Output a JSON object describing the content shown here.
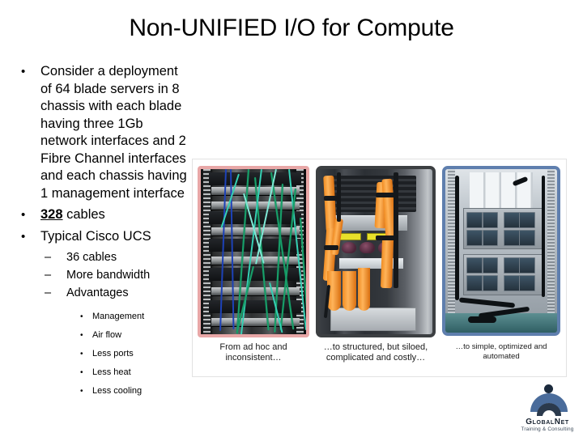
{
  "slide": {
    "title": "Non-UNIFIED I/O for Compute"
  },
  "bullets": {
    "level1": [
      {
        "marker": "•",
        "text": "Consider a deployment of 64 blade servers in 8 chassis with each blade having three 1Gb network interfaces and 2 Fibre Channel interfaces and each chassis having 1 management interface"
      },
      {
        "marker": "•",
        "emphasis": "328",
        "text": " cables"
      },
      {
        "marker": "•",
        "text": "Typical Cisco UCS"
      }
    ],
    "level2": [
      {
        "marker": "–",
        "text": "36 cables"
      },
      {
        "marker": "–",
        "text": "More bandwidth"
      },
      {
        "marker": "–",
        "text": "Advantages"
      }
    ],
    "level3": [
      {
        "marker": "•",
        "text": "Management"
      },
      {
        "marker": "•",
        "text": "Air flow"
      },
      {
        "marker": "•",
        "text": "Less ports"
      },
      {
        "marker": "•",
        "text": "Less heat"
      },
      {
        "marker": "•",
        "text": "Less cooling"
      }
    ]
  },
  "figures": {
    "panels": [
      {
        "name": "messy-cabling-rack-photo",
        "caption": "From ad hoc and inconsistent…",
        "border_color": "#e8a7a7"
      },
      {
        "name": "orange-cabling-rack-photo",
        "caption": "…to structured, but siloed, complicated and costly…",
        "border_color": "#3c3f42"
      },
      {
        "name": "ucs-chassis-photo",
        "caption": "…to simple, optimized and automated",
        "border_color": "#5f7fae"
      }
    ]
  },
  "logo": {
    "name": "GlobalNet",
    "tagline": "Training & Consulting",
    "mark_color": "#4a6c9b"
  }
}
